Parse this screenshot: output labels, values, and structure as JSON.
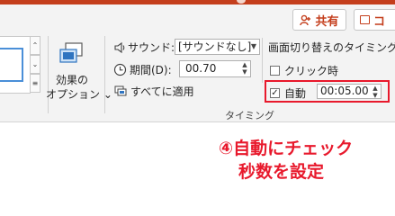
{
  "header": {
    "share_label": "共有",
    "comment_label": "コ"
  },
  "gallery": {
    "scroll_up": "⌃",
    "scroll_down": "⌄",
    "more": "≡"
  },
  "effect_options": {
    "label_line1": "効果の",
    "label_line2": "オプション ⌄"
  },
  "timing": {
    "sound_label": "サウンド:",
    "sound_value": "[サウンドなし]",
    "duration_label": "期間(D):",
    "duration_value": "00.70",
    "apply_all_label": "すべてに適用",
    "advance_title": "画面切り替えのタイミング",
    "on_click_label": "クリック時",
    "on_click_checked": false,
    "auto_label": "自動",
    "auto_checked": true,
    "auto_time": "00:05.00",
    "group_label": "タイミング"
  },
  "annotation": {
    "line1": "④自動にチェック",
    "line2": "秒数を設定",
    "color": "#e8192c"
  },
  "colors": {
    "accent": "#c43e1c",
    "highlight": "#e8192c"
  }
}
